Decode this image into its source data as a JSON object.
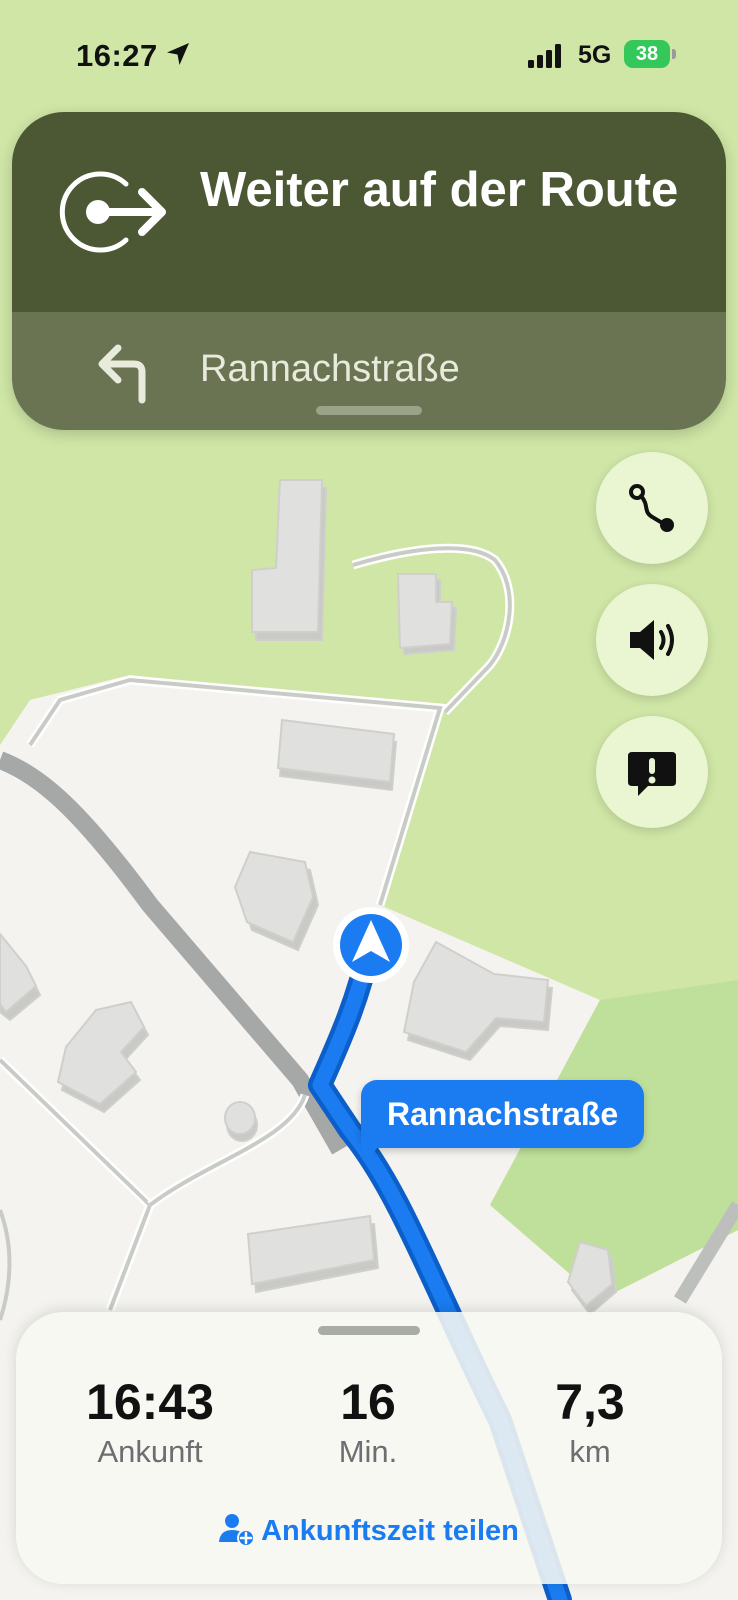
{
  "status_bar": {
    "time": "16:27",
    "network": "5G",
    "battery": "38",
    "location_icon": "location-arrow-icon",
    "signal_icon": "cellular-signal-icon",
    "battery_icon": "battery-charging-icon"
  },
  "guidance": {
    "instruction": "Weiter auf der Route",
    "maneuver_icon": "continue-route-icon",
    "next_street": "Rannachstraße",
    "next_icon": "turn-left-icon"
  },
  "map": {
    "street_callout": "Rannachstraße",
    "user_marker_icon": "navigation-arrow-icon",
    "route_color": "#1a7cf0"
  },
  "map_controls": [
    {
      "icon": "route-overview-icon"
    },
    {
      "icon": "speaker-icon"
    },
    {
      "icon": "report-incident-icon"
    }
  ],
  "trip": {
    "arrival_time": "16:43",
    "arrival_label": "Ankunft",
    "minutes": "16",
    "minutes_label": "Min.",
    "distance": "7,3",
    "distance_label": "km",
    "share_label": "Ankunftszeit teilen",
    "share_icon": "share-person-icon"
  },
  "colors": {
    "banner_primary": "#4c5833",
    "banner_secondary": "#6a7452",
    "accent": "#1a7cf0",
    "battery": "#34c759"
  }
}
